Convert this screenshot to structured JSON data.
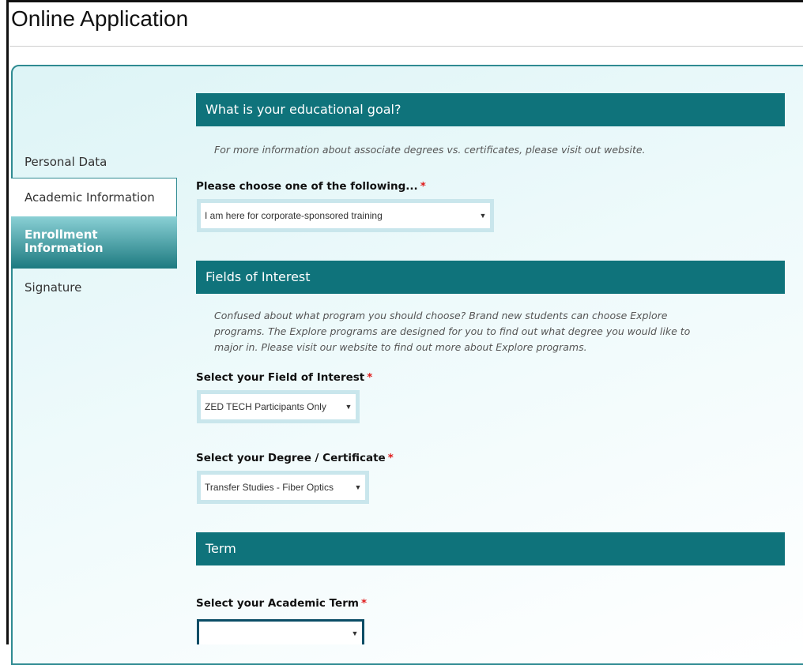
{
  "app": {
    "title": "Online Application"
  },
  "sidebar": {
    "items": [
      {
        "label": "Personal Data"
      },
      {
        "label": "Academic Information"
      },
      {
        "label": "Enrollment Information",
        "active": true
      },
      {
        "label": "Signature"
      }
    ]
  },
  "sections": {
    "goal": {
      "title": "What is your educational goal?",
      "hint": "For more information about associate degrees vs. certificates, please visit out website.",
      "label": "Please choose one of the following...",
      "value": "I am here for corporate-sponsored training"
    },
    "interest": {
      "title": "Fields of Interest",
      "hint": "Confused about what program you should choose? Brand new students can choose Explore programs. The Explore programs are designed for you to find out what degree you would like to major in. Please visit our website to find out more about Explore programs.",
      "field_label": "Select your Field of Interest",
      "field_value": "ZED TECH Participants Only",
      "degree_label": "Select your Degree / Certificate",
      "degree_value": "Transfer Studies - Fiber Optics"
    },
    "term": {
      "title": "Term",
      "label": "Select your Academic Term",
      "value": ""
    }
  },
  "required_marker": "*",
  "colors": {
    "accent": "#0f737b",
    "required": "#e01b1b",
    "select_border": "#c9e6ec"
  },
  "icons": {
    "dropdown": "▼"
  }
}
